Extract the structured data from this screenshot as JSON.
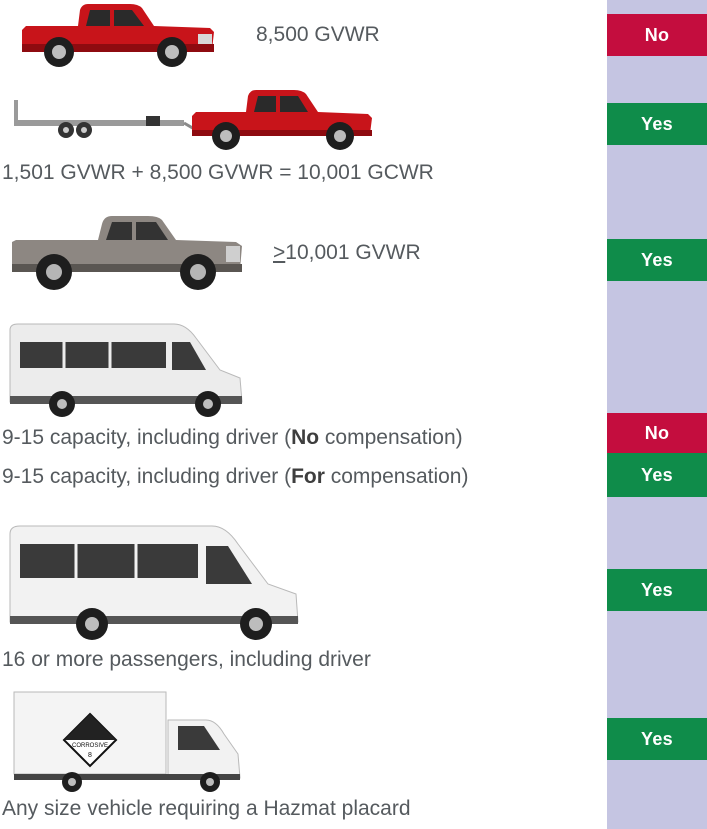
{
  "colors": {
    "no": "#c40d3e",
    "yes": "#0f8c4a",
    "column_bg": "#c5c5e2",
    "text": "#555a5e"
  },
  "rows": [
    {
      "text": "8,500 GVWR",
      "badge": "No",
      "vehicle_icon": "red-pickup-truck-icon"
    },
    {
      "text": "1,501 GVWR + 8,500 GVWR = 10,001 GCWR",
      "badge": "Yes",
      "vehicle_icon": "pickup-with-trailer-icon"
    },
    {
      "ge_symbol": ">",
      "text": "10,001 GVWR",
      "badge": "Yes",
      "vehicle_icon": "gray-heavy-pickup-icon"
    },
    {
      "text_pre": "9-15 capacity, including driver (",
      "text_bold": "No",
      "text_post": " compensation)",
      "badge": "No",
      "vehicle_icon": "passenger-van-icon"
    },
    {
      "text_pre": "9-15 capacity, including driver (",
      "text_bold": "For",
      "text_post": " compensation)",
      "badge": "Yes"
    },
    {
      "text": "16 or more passengers, including driver",
      "badge": "Yes",
      "vehicle_icon": "large-passenger-van-icon"
    },
    {
      "text": "Any size vehicle requiring a Hazmat placard",
      "badge": "Yes",
      "vehicle_icon": "box-truck-hazmat-icon",
      "placard_text": "CORROSIVE",
      "placard_class": "8"
    }
  ]
}
